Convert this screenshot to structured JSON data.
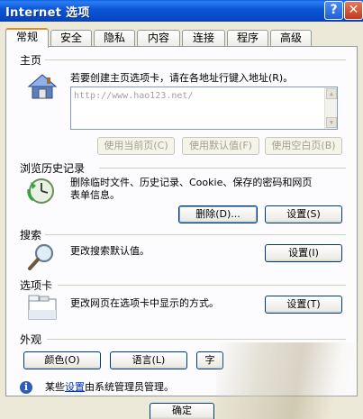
{
  "window": {
    "title": "Internet 选项",
    "help": "?",
    "close": "✕"
  },
  "tabs": [
    "常规",
    "安全",
    "隐私",
    "内容",
    "连接",
    "程序",
    "高级"
  ],
  "home": {
    "title": "主页",
    "description": "若要创建主页选项卡，请在各地址行键入地址(R)。",
    "url": "http://www.hao123.net/",
    "buttons": [
      "使用当前页(C)",
      "使用默认值(F)",
      "使用空白页(B)"
    ]
  },
  "history": {
    "title": "浏览历史记录",
    "description_line1": "删除临时文件、历史记录、Cookie、保存的密码和网页",
    "description_line2": "表单信息。",
    "delete_button": "删除(D)...",
    "settings_button": "设置(S)"
  },
  "search": {
    "title": "搜索",
    "description": "更改搜索默认值。",
    "settings_button": "设置(I)"
  },
  "tabs_section": {
    "title": "选项卡",
    "description": "更改网页在选项卡中显示的方式。",
    "settings_button": "设置(T)"
  },
  "appearance": {
    "title": "外观",
    "buttons": [
      "颜色(O)",
      "语言(L)",
      "字"
    ]
  },
  "info": {
    "prefix": "某些",
    "link": "设置",
    "suffix": "由系统管理员管理。"
  },
  "footer": {
    "ok_button": "确定"
  }
}
